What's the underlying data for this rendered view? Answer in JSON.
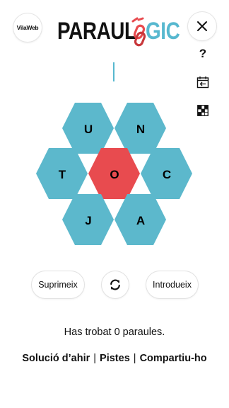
{
  "header": {
    "brand_badge": "VilaWeb",
    "logo_left": "PARAUL",
    "logo_right": "GIC",
    "close_icon": "close-icon"
  },
  "side_icons": {
    "help_label": "?",
    "calendar_icon": "calendar-back-icon",
    "grid_icon": "crossword-grid-icon"
  },
  "game": {
    "current_word": "",
    "letters": {
      "top_left": "U",
      "top_right": "N",
      "mid_left": "T",
      "center": "O",
      "mid_right": "C",
      "bottom_left": "J",
      "bottom_right": "A"
    },
    "colors": {
      "outer": "#5cb8cc",
      "center": "#e84b4f",
      "accent": "#57b8cf"
    }
  },
  "controls": {
    "delete_label": "Suprimeix",
    "shuffle_icon": "shuffle-icon",
    "enter_label": "Introdueix"
  },
  "status": {
    "found_text": "Has trobat 0 paraules."
  },
  "footer": {
    "yesterday_solution": "Solució d’ahir",
    "separator": "|",
    "hints": "Pistes",
    "share": "Compartiu-ho"
  }
}
